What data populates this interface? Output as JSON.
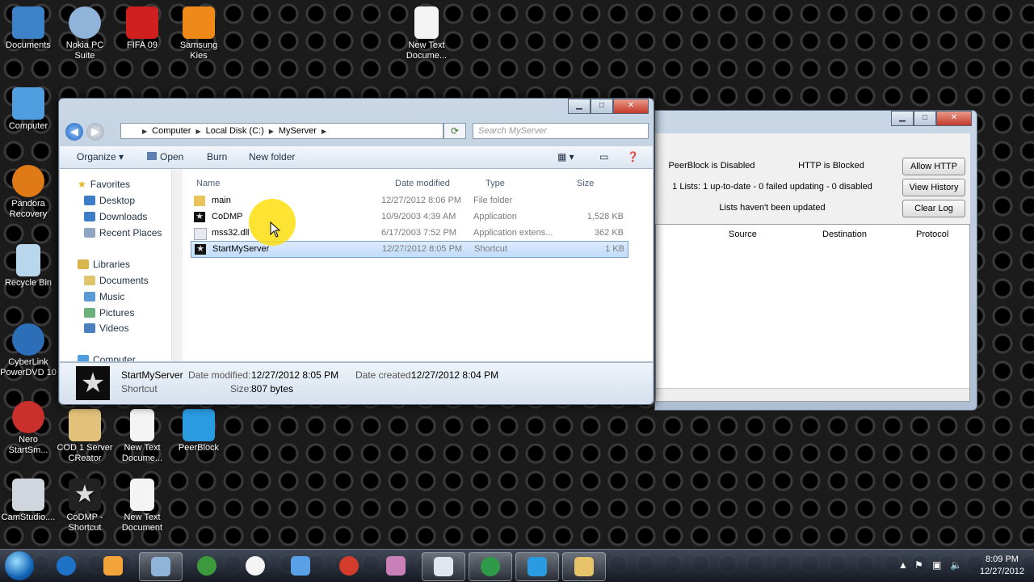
{
  "desktop": {
    "icons": [
      {
        "label": "Documents",
        "color": "#3b82c9"
      },
      {
        "label": "Nokia PC Suite",
        "color": "#8fb3d9"
      },
      {
        "label": "FIFA 09",
        "color": "#d11f1f"
      },
      {
        "label": "Samsung Kies",
        "color": "#ef8a1a"
      },
      {
        "label": "New Text Docume...",
        "color": "#f4f4f4"
      },
      {
        "label": "Computer",
        "color": "#4f9ee0"
      },
      {
        "label": "Pandora Recovery",
        "color": "#e07a16"
      },
      {
        "label": "Recycle Bin",
        "color": "#b8d6ec"
      },
      {
        "label": "CyberLink PowerDVD 10",
        "color": "#2c6fb8"
      },
      {
        "label": "Nero StartSm...",
        "color": "#c9302c"
      },
      {
        "label": "COD 1 Server CReator",
        "color": "#e2c27a"
      },
      {
        "label": "New Text Docume...",
        "color": "#f4f4f4"
      },
      {
        "label": "PeerBlock",
        "color": "#2a9be0"
      },
      {
        "label": "CamStudio....",
        "color": "#cfd6de"
      },
      {
        "label": "CoDMP - Shortcut",
        "color": "#222222"
      },
      {
        "label": "New Text Document",
        "color": "#f4f4f4"
      }
    ]
  },
  "explorer": {
    "window_controls": {
      "minimize": "▁",
      "maximize": "□",
      "close": "✕"
    },
    "back": "◀",
    "forward": "▶",
    "breadcrumb": [
      "Computer",
      "Local Disk (C:)",
      "MyServer"
    ],
    "search_placeholder": "Search MyServer",
    "toolbar": {
      "organize": "Organize ▾",
      "open": "Open",
      "burn": "Burn",
      "new_folder": "New folder"
    },
    "nav": {
      "favorites": "Favorites",
      "fav_items": [
        "Desktop",
        "Downloads",
        "Recent Places"
      ],
      "libraries": "Libraries",
      "lib_items": [
        "Documents",
        "Music",
        "Pictures",
        "Videos"
      ],
      "computer": "Computer"
    },
    "columns": {
      "name": "Name",
      "date": "Date modified",
      "type": "Type",
      "size": "Size"
    },
    "files": [
      {
        "name": "main",
        "date": "12/27/2012 8:06 PM",
        "type": "File folder",
        "size": ""
      },
      {
        "name": "CoDMP",
        "date": "10/9/2003 4:39 AM",
        "type": "Application",
        "size": "1,528 KB"
      },
      {
        "name": "mss32.dll",
        "date": "6/17/2003 7:52 PM",
        "type": "Application extens...",
        "size": "362 KB"
      },
      {
        "name": "StartMyServer",
        "date": "12/27/2012 8:05 PM",
        "type": "Shortcut",
        "size": "1 KB"
      }
    ],
    "details": {
      "name": "StartMyServer",
      "kind": "Shortcut",
      "modified_label": "Date modified:",
      "modified": "12/27/2012 8:05 PM",
      "created_label": "Date created:",
      "created": "12/27/2012 8:04 PM",
      "size_label": "Size:",
      "size": "807 bytes"
    }
  },
  "peerblock": {
    "status": "PeerBlock is Disabled",
    "http_status": "HTTP is Blocked",
    "allow_http": "Allow HTTP",
    "lists": "1 Lists: 1 up-to-date - 0 failed updating - 0 disabled",
    "view_history": "View History",
    "updates": "Lists haven't been updated",
    "clear_log": "Clear Log",
    "columns": [
      "Source",
      "Destination",
      "Protocol"
    ]
  },
  "taskbar": {
    "time": "8:09 PM",
    "date": "12/27/2012",
    "apps": [
      "#1e73c8",
      "#f2a33a",
      "#8fb3d9",
      "#3c9a3c",
      "#f4f4f4",
      "#5aa0e6",
      "#d33b2c",
      "#c97fb8",
      "#dfe6ee",
      "#2f9b49",
      "#2a9be0",
      "#e7c36a"
    ]
  }
}
